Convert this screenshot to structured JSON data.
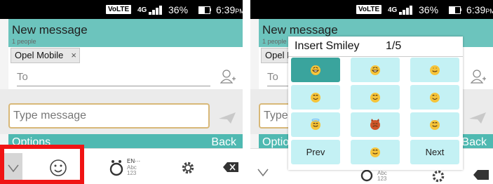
{
  "status_bar": {
    "volte": "VoLTE",
    "network": "4G",
    "battery_pct": "36%",
    "time": "6:39",
    "time_suffix": "PM"
  },
  "header": {
    "title": "New message",
    "subtitle": "1 people"
  },
  "recipient_chip": {
    "label": "Opel Mobile",
    "remove": "×"
  },
  "to_field": {
    "placeholder": "To"
  },
  "message_input": {
    "placeholder": "Type message"
  },
  "options_bar": {
    "left": "Options",
    "right": "Back"
  },
  "keyboard": {
    "lang": "EN···",
    "abc": "Abc",
    "nums": "123"
  },
  "popup": {
    "title": "Insert Smiley",
    "page": "1/5",
    "prev": "Prev",
    "next": "Next",
    "smileys": [
      "laughing-smiley",
      "grinning-smiley",
      "smile-smiley",
      "blush-smiley",
      "happy-smiley",
      "wink-smiley",
      "angel-smiley",
      "devil-smiley",
      "grin-smiley",
      "cool-smiley"
    ]
  },
  "colors": {
    "teal": "#4fb9b1",
    "teal_light": "#6cc4bd",
    "highlight": "#f01414",
    "smiley_cell": "#c4f1f4",
    "selected_cell": "#3aa49d"
  }
}
